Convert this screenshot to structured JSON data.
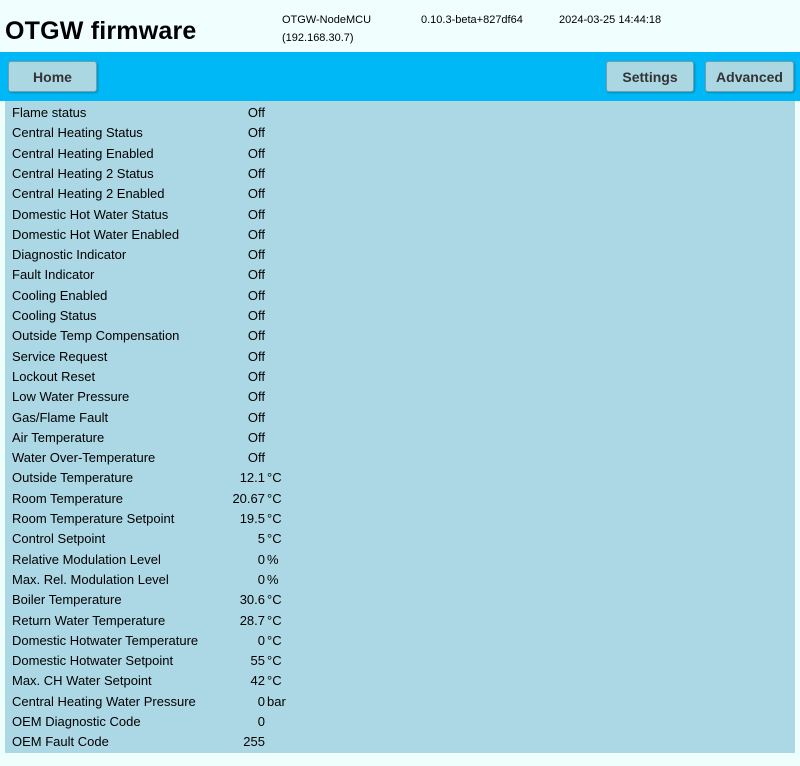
{
  "header": {
    "title": "OTGW firmware",
    "device_name": "OTGW-NodeMCU",
    "device_ip": "(192.168.30.7)",
    "version": "0.10.3-beta+827df64",
    "datetime": "2024-03-25 14:44:18"
  },
  "nav": {
    "home_label": "Home",
    "settings_label": "Settings",
    "advanced_label": "Advanced"
  },
  "rows": [
    {
      "label": "Flame status",
      "value": "Off",
      "unit": ""
    },
    {
      "label": "Central Heating Status",
      "value": "Off",
      "unit": ""
    },
    {
      "label": "Central Heating Enabled",
      "value": "Off",
      "unit": ""
    },
    {
      "label": "Central Heating 2 Status",
      "value": "Off",
      "unit": ""
    },
    {
      "label": "Central Heating 2 Enabled",
      "value": "Off",
      "unit": ""
    },
    {
      "label": "Domestic Hot Water Status",
      "value": "Off",
      "unit": ""
    },
    {
      "label": "Domestic Hot Water Enabled",
      "value": "Off",
      "unit": ""
    },
    {
      "label": "Diagnostic Indicator",
      "value": "Off",
      "unit": ""
    },
    {
      "label": "Fault Indicator",
      "value": "Off",
      "unit": ""
    },
    {
      "label": "Cooling Enabled",
      "value": "Off",
      "unit": ""
    },
    {
      "label": "Cooling Status",
      "value": "Off",
      "unit": ""
    },
    {
      "label": "Outside Temp Compensation",
      "value": "Off",
      "unit": ""
    },
    {
      "label": "Service Request",
      "value": "Off",
      "unit": ""
    },
    {
      "label": "Lockout Reset",
      "value": "Off",
      "unit": ""
    },
    {
      "label": "Low Water Pressure",
      "value": "Off",
      "unit": ""
    },
    {
      "label": "Gas/Flame Fault",
      "value": "Off",
      "unit": ""
    },
    {
      "label": "Air Temperature",
      "value": "Off",
      "unit": ""
    },
    {
      "label": "Water Over-Temperature",
      "value": "Off",
      "unit": ""
    },
    {
      "label": "Outside Temperature",
      "value": "12.1",
      "unit": "°C"
    },
    {
      "label": "Room Temperature",
      "value": "20.67",
      "unit": "°C"
    },
    {
      "label": "Room Temperature Setpoint",
      "value": "19.5",
      "unit": "°C"
    },
    {
      "label": "Control Setpoint",
      "value": "5",
      "unit": "°C"
    },
    {
      "label": "Relative Modulation Level",
      "value": "0",
      "unit": "%"
    },
    {
      "label": "Max. Rel. Modulation Level",
      "value": "0",
      "unit": "%"
    },
    {
      "label": "Boiler Temperature",
      "value": "30.6",
      "unit": "°C"
    },
    {
      "label": "Return Water Temperature",
      "value": "28.7",
      "unit": "°C"
    },
    {
      "label": "Domestic Hotwater Temperature",
      "value": "0",
      "unit": "°C"
    },
    {
      "label": "Domestic Hotwater Setpoint",
      "value": "55",
      "unit": "°C"
    },
    {
      "label": "Max. CH Water Setpoint",
      "value": "42",
      "unit": "°C"
    },
    {
      "label": "Central Heating Water Pressure",
      "value": "0",
      "unit": "bar"
    },
    {
      "label": "OEM Diagnostic Code",
      "value": "0",
      "unit": ""
    },
    {
      "label": "OEM Fault Code",
      "value": "255",
      "unit": ""
    }
  ]
}
